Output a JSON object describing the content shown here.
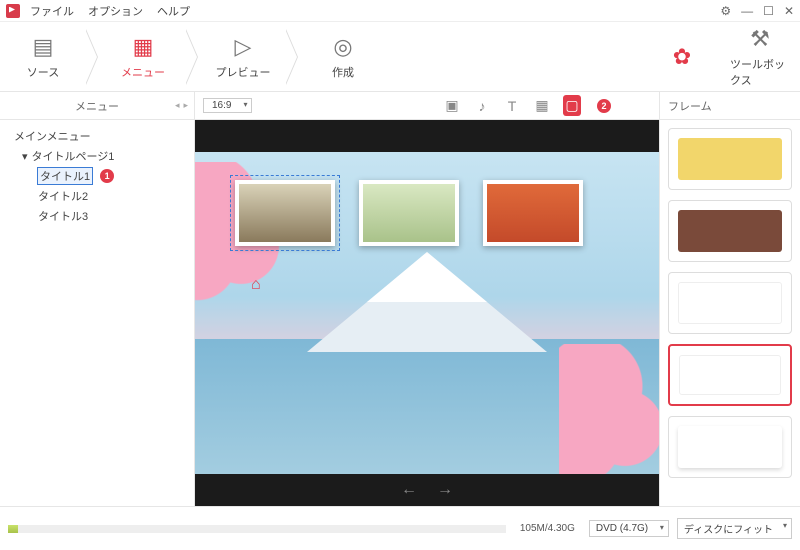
{
  "menubar": {
    "file": "ファイル",
    "options": "オプション",
    "help": "ヘルプ"
  },
  "window_controls": {
    "gear": "⚙",
    "min": "—",
    "max": "☐",
    "close": "✕"
  },
  "nav": {
    "source": "ソース",
    "menu": "メニュー",
    "preview": "プレビュー",
    "create": "作成",
    "gift": "",
    "toolbox": "ツールボックス"
  },
  "sidebar": {
    "header": "メニュー",
    "tree": {
      "root": "メインメニュー",
      "page": "タイトルページ1",
      "items": [
        "タイトル1",
        "タイトル2",
        "タイトル3"
      ]
    }
  },
  "annotations": {
    "one": "1",
    "two": "2"
  },
  "toolbar": {
    "aspect": "16:9"
  },
  "rightpanel": {
    "header": "フレーム"
  },
  "status": {
    "size": "105M/4.30G",
    "disc": "DVD (4.7G)",
    "fit": "ディスクにフィット"
  },
  "nav_arrows": {
    "prev": "←",
    "next": "→"
  }
}
